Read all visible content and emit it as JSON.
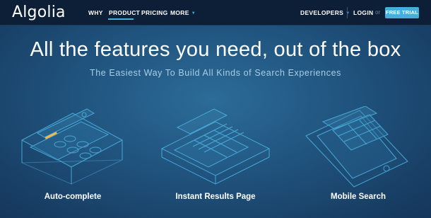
{
  "nav": {
    "logo": "Algolia",
    "items": [
      {
        "label": "WHY"
      },
      {
        "label": "PRODUCT",
        "active": true
      },
      {
        "label": "PRICING"
      },
      {
        "label": "MORE"
      }
    ],
    "right": {
      "developers": "DEVELOPERS",
      "login": "LOGIN",
      "or": "or",
      "trial": "FREE TRIAL"
    }
  },
  "hero": {
    "title": "All the features you need, out of the box",
    "subtitle": "The Easiest Way To Build All Kinds of Search Experiences"
  },
  "features": [
    {
      "label": "Auto-complete",
      "illustration": "autocomplete-illustration"
    },
    {
      "label": "Instant Results Page",
      "illustration": "results-page-illustration"
    },
    {
      "label": "Mobile Search",
      "illustration": "mobile-illustration"
    }
  ],
  "colors": {
    "navbar": "#0d1f36",
    "accent": "#46aeda",
    "background": "#1f527c",
    "line_art": "#4fb6e4"
  }
}
